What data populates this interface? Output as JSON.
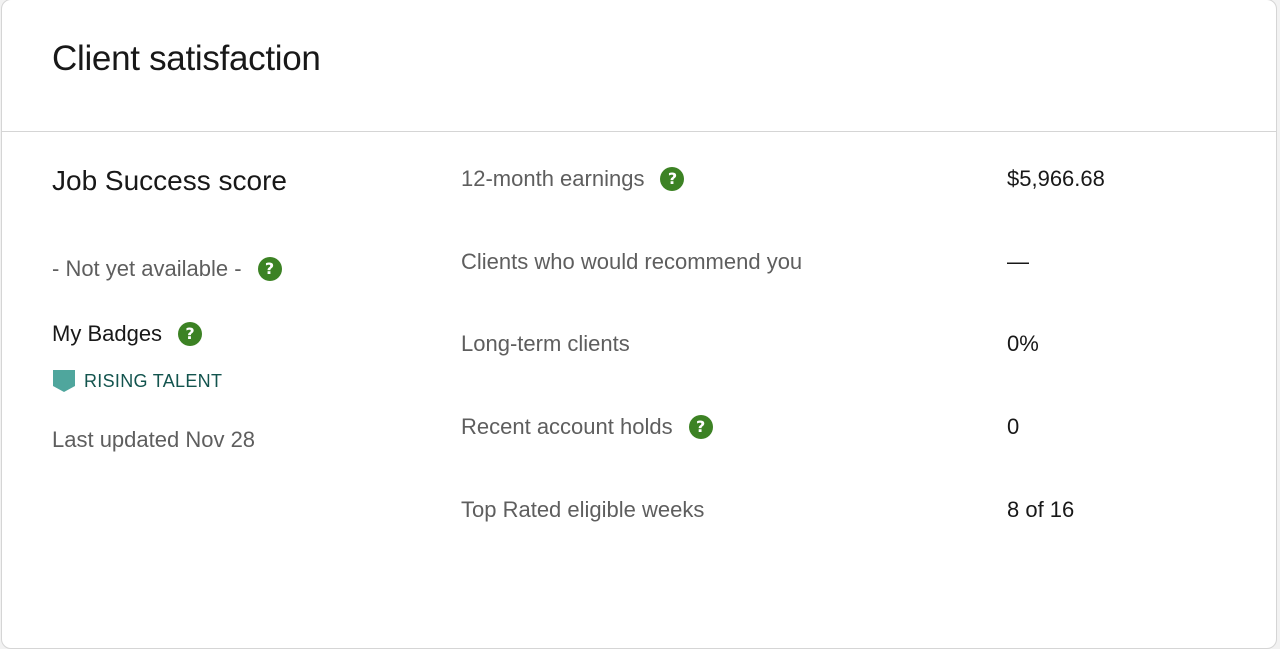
{
  "header": {
    "title": "Client satisfaction"
  },
  "job_success": {
    "title": "Job Success score",
    "status": "- Not yet available -",
    "help_icon": "question-circle-icon"
  },
  "badges": {
    "title": "My Badges",
    "help_icon": "question-circle-icon",
    "items": [
      {
        "label": "RISING TALENT",
        "icon": "shield-badge-icon",
        "color": "#4fa69d"
      }
    ]
  },
  "last_updated": "Last updated Nov 28",
  "stats": [
    {
      "label": "12-month earnings",
      "value": "$5,966.68",
      "has_help": true
    },
    {
      "label": "Clients who would recommend you",
      "value": "—",
      "has_help": false
    },
    {
      "label": "Long-term clients",
      "value": "0%",
      "has_help": false
    },
    {
      "label": "Recent account holds",
      "value": "0",
      "has_help": true
    },
    {
      "label": "Top Rated eligible weeks",
      "value": "8 of 16",
      "has_help": false
    }
  ],
  "help_icon_glyph": "?",
  "colors": {
    "accent_green": "#3c8224",
    "badge_teal": "#4fa69d",
    "badge_text": "#13544e",
    "muted_text": "#5e5e5e",
    "primary_text": "#181818"
  }
}
